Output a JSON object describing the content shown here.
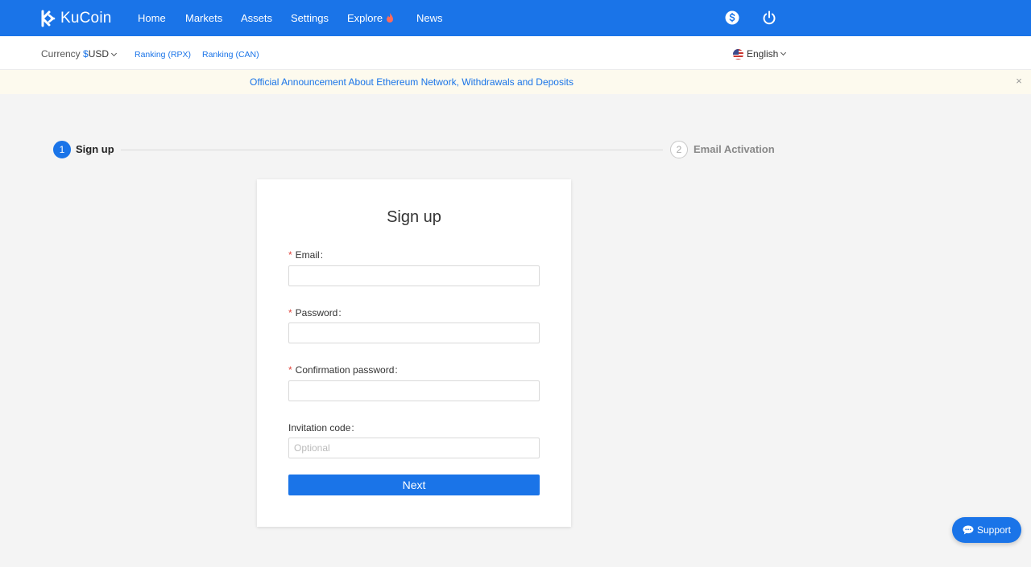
{
  "brand": {
    "name": "KuCoin",
    "icon": "kucoin-logo-icon",
    "color": "#1a74e8"
  },
  "nav": {
    "items": [
      {
        "label": "Home"
      },
      {
        "label": "Markets"
      },
      {
        "label": "Assets"
      },
      {
        "label": "Settings"
      },
      {
        "label": "Explore",
        "icon": "flame-icon"
      },
      {
        "label": "News"
      }
    ],
    "right_icons": [
      "dollar-icon",
      "power-icon"
    ]
  },
  "subbar": {
    "currency_label": "Currency",
    "currency_symbol": "$",
    "currency_value": "USD",
    "ranking_rpx": "Ranking (RPX)",
    "ranking_can": "Ranking (CAN)",
    "language": "English"
  },
  "announcement": {
    "text": "Official Announcement About Ethereum Network, Withdrawals and Deposits",
    "close": "×"
  },
  "steps": [
    {
      "number": "1",
      "label": "Sign up",
      "active": true
    },
    {
      "number": "2",
      "label": "Email Activation",
      "active": false
    }
  ],
  "form": {
    "title": "Sign up",
    "fields": [
      {
        "label": "Email",
        "required": true,
        "value": "",
        "placeholder": ""
      },
      {
        "label": "Password",
        "required": true,
        "value": "",
        "placeholder": ""
      },
      {
        "label": "Confirmation password",
        "required": true,
        "value": "",
        "placeholder": ""
      },
      {
        "label": "Invitation code",
        "required": false,
        "value": "",
        "placeholder": "Optional"
      }
    ],
    "required_mark": "*",
    "colon": ":",
    "submit_label": "Next"
  },
  "support": {
    "label": "Support",
    "icon": "chat-icon"
  }
}
